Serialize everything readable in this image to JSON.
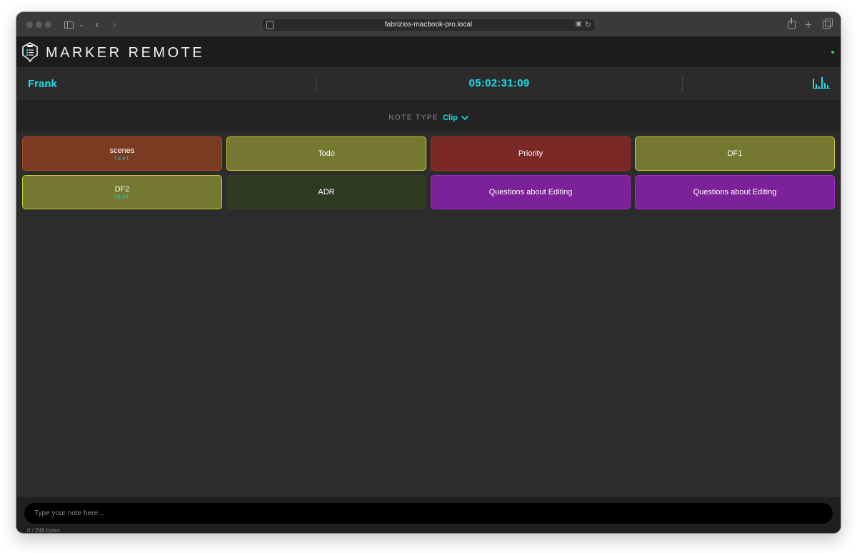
{
  "browser": {
    "url": "fabrizios-macbook-pro.local",
    "icons": [
      "sidebar-icon",
      "chevron-down-icon",
      "back-icon",
      "forward-icon",
      "page-icon",
      "translate-icon",
      "reload-icon",
      "share-icon",
      "plus-icon",
      "tabs-icon"
    ]
  },
  "app": {
    "title": "MARKER REMOTE",
    "status_color": "#30d158",
    "accent": "#19e0e8"
  },
  "info": {
    "user": "Frank",
    "timecode": "05:02:31:09"
  },
  "note_type": {
    "label": "NOTE TYPE",
    "value": "Clip"
  },
  "tiles": [
    {
      "label": "scenes",
      "sub": "TEXT",
      "bg": "#7b3b22",
      "border": "#b04a22"
    },
    {
      "label": "Todo",
      "sub": "",
      "bg": "#757830",
      "border": "#c8cc2a"
    },
    {
      "label": "Priority",
      "sub": "",
      "bg": "#7a2826",
      "border": "#a8302a"
    },
    {
      "label": "DF1",
      "sub": "",
      "bg": "#757830",
      "border": "#c8cc2a"
    },
    {
      "label": "DF2",
      "sub": "TEXT",
      "bg": "#757830",
      "border": "#c8cc2a"
    },
    {
      "label": "ADR",
      "sub": "",
      "bg": "#2e3a22",
      "border": "#34402a"
    },
    {
      "label": "Questions about Editing",
      "sub": "",
      "bg": "#7b2299",
      "border": "#a526d4"
    },
    {
      "label": "Questions about Editing",
      "sub": "",
      "bg": "#7b2299",
      "border": "#a526d4"
    }
  ],
  "note": {
    "placeholder": "Type your note here...",
    "counter": "0 / 248 bytes"
  }
}
